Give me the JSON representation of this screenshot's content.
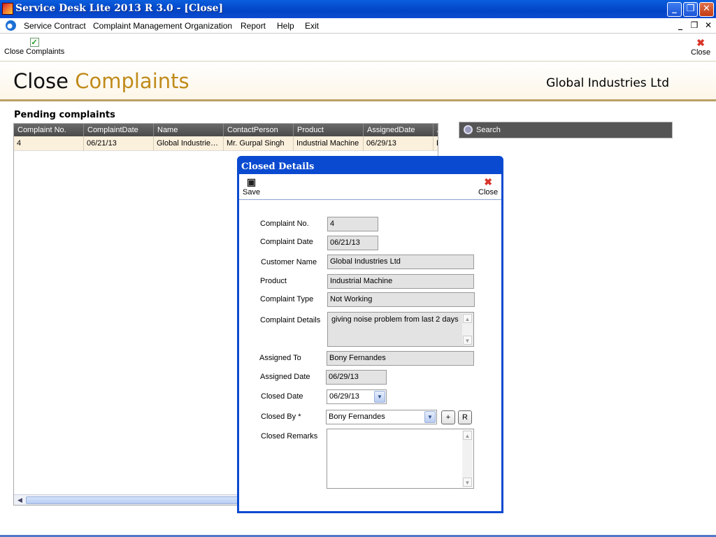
{
  "window": {
    "title": "Service Desk Lite 2013 R 3.0 - [Close]",
    "minimize": "_",
    "restore": "❐",
    "close": "✕",
    "icon": "app-logo-icon"
  },
  "menu": {
    "items": [
      "Service Contract",
      "Complaint Management",
      "Organization",
      "Report",
      "Help",
      "Exit"
    ],
    "mdi_minimize": "_",
    "mdi_restore": "❐",
    "mdi_close": "✕"
  },
  "toolbar": {
    "close_complaints_label": "Close Complaints",
    "close_complaints_icon": "✓",
    "close_label": "Close",
    "close_icon": "✖"
  },
  "header": {
    "title_part1": "Close",
    "title_part2": "Complaints",
    "company": "Global Industries Ltd",
    "accent_color": "#c08b1a"
  },
  "pending": {
    "title": "Pending complaints",
    "columns": [
      "Complaint No.",
      "ComplaintDate",
      "Name",
      "ContactPerson",
      "Product",
      "AssignedDate",
      "A"
    ],
    "rows": [
      [
        "4",
        "06/21/13",
        "Global Industrie…",
        "Mr. Gurpal Singh",
        "Industrial Machine",
        "06/29/13",
        "E"
      ]
    ]
  },
  "search": {
    "placeholder": "Search"
  },
  "dialog": {
    "title": "Closed Details",
    "save_label": "Save",
    "close_label": "Close",
    "fields": {
      "complaint_no": {
        "label": "Complaint No.",
        "value": "4"
      },
      "complaint_date": {
        "label": "Complaint Date",
        "value": "06/21/13"
      },
      "customer_name": {
        "label": "Customer Name",
        "value": "Global Industries Ltd"
      },
      "product": {
        "label": "Product",
        "value": "Industrial Machine"
      },
      "complaint_type": {
        "label": "Complaint Type",
        "value": "Not Working"
      },
      "complaint_details": {
        "label": "Complaint Details",
        "value": "giving noise problem from last 2 days"
      },
      "assigned_to": {
        "label": "Assigned To",
        "value": "Bony Fernandes"
      },
      "assigned_date": {
        "label": "Assigned Date",
        "value": "06/29/13"
      },
      "closed_date": {
        "label": "Closed Date",
        "value": "06/29/13"
      },
      "closed_by": {
        "label": "Closed By *",
        "value": "Bony Fernandes"
      },
      "closed_remarks": {
        "label": "Closed Remarks",
        "value": ""
      }
    },
    "add_button": "+",
    "refresh_button": "R"
  }
}
